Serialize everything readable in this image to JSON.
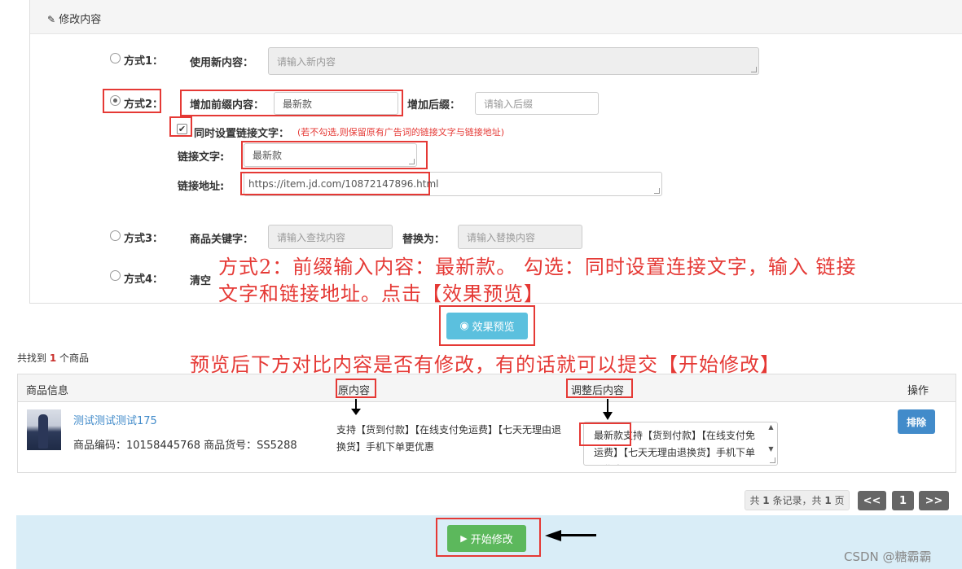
{
  "panel": {
    "title": "修改内容"
  },
  "method1": {
    "label": "方式1：",
    "field_label": "使用新内容：",
    "placeholder": "请输入新内容"
  },
  "method2": {
    "label": "方式2：",
    "prefix_label": "增加前缀内容：",
    "prefix_value": "最新款",
    "suffix_label": "增加后缀：",
    "suffix_placeholder": "请输入后缀",
    "check_label": "同时设置链接文字：",
    "check_note": "(若不勾选,则保留原有广告词的链接文字与链接地址)",
    "link_text_label": "链接文字:",
    "link_text_value": "最新款",
    "link_url_label": "链接地址:",
    "link_url_value": "https://item.jd.com/10872147896.html"
  },
  "method3": {
    "label": "方式3：",
    "keyword_label": "商品关键字：",
    "keyword_placeholder": "请输入查找内容",
    "replace_label": "替换为：",
    "replace_placeholder": "请输入替换内容"
  },
  "method4": {
    "label": "方式4：",
    "field_label": "清空"
  },
  "annotations": {
    "a1_line1": "方式2：前缀输入内容：最新款。 勾选：同时设置连接文字，输入 链接",
    "a1_line2": "文字和链接地址。点击【效果预览】",
    "a2": "预览后下方对比内容是否有修改，有的话就可以提交【开始修改】"
  },
  "preview_button": "效果预览",
  "result": {
    "prefix": "共找到",
    "count": "1",
    "suffix": "个商品"
  },
  "table": {
    "headers": {
      "info": "商品信息",
      "original": "原内容",
      "adjusted": "调整后内容",
      "action": "操作"
    },
    "row": {
      "title": "测试测试测试175",
      "meta": "商品编码：10158445768 商品货号：SS5288",
      "original": "支持【货到付款】【在线支付免运费】【七天无理由退换货】手机下单更优惠",
      "adjusted_prefix": "最新款",
      "adjusted_rest": "支持【货到付款】【在线支付免运费】【七天无理由退换货】手机下单更优惠",
      "action": "排除"
    }
  },
  "pagination": {
    "summary_1": "共",
    "records": "1",
    "summary_2": "条记录，共",
    "pages": "1",
    "summary_3": "页",
    "prev": "<<",
    "page": "1",
    "next": ">>"
  },
  "start_button": "开始修改",
  "watermark": "CSDN @糖霸霸"
}
